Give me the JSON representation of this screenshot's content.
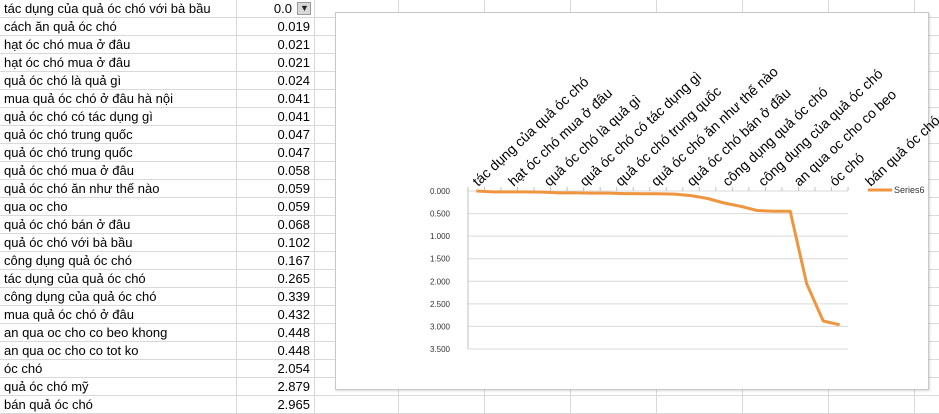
{
  "sheet": {
    "rows": [
      {
        "keyword": "tác dụng của quả óc chó với bà bầu",
        "value": "0.0"
      },
      {
        "keyword": "cách ăn quả óc chó",
        "value": "0.019"
      },
      {
        "keyword": "hạt óc chó mua ở đâu",
        "value": "0.021"
      },
      {
        "keyword": "hạt óc chó mua ở đâu",
        "value": "0.021"
      },
      {
        "keyword": "quả óc chó là quả gì",
        "value": "0.024"
      },
      {
        "keyword": "mua quả óc chó ở đâu hà nội",
        "value": "0.041"
      },
      {
        "keyword": "quả óc chó có tác dụng gì",
        "value": "0.041"
      },
      {
        "keyword": "quả óc chó trung quốc",
        "value": "0.047"
      },
      {
        "keyword": "quả óc chó trung quốc",
        "value": "0.047"
      },
      {
        "keyword": "quả óc chó mua ở đâu",
        "value": "0.058"
      },
      {
        "keyword": "quả óc chó ăn như thế nào",
        "value": "0.059"
      },
      {
        "keyword": "qua oc cho",
        "value": "0.059"
      },
      {
        "keyword": "quả óc chó bán ở đâu",
        "value": "0.068"
      },
      {
        "keyword": "quả óc chó với bà bầu",
        "value": "0.102"
      },
      {
        "keyword": "công dụng quả óc chó",
        "value": "0.167"
      },
      {
        "keyword": "tác dụng của quả óc chó",
        "value": "0.265"
      },
      {
        "keyword": "công dụng của quả óc chó",
        "value": "0.339"
      },
      {
        "keyword": "mua quả óc chó ở đâu",
        "value": "0.432"
      },
      {
        "keyword": "an qua oc cho co beo khong",
        "value": "0.448"
      },
      {
        "keyword": "an qua oc cho co tot ko",
        "value": "0.448"
      },
      {
        "keyword": "óc chó",
        "value": "2.054"
      },
      {
        "keyword": "quả óc chó mỹ",
        "value": "2.879"
      },
      {
        "keyword": "bán quả óc chó",
        "value": "2.965"
      }
    ]
  },
  "chart_data": {
    "type": "line",
    "y_inverted": true,
    "ylim": [
      0,
      3.5
    ],
    "y_ticks": [
      "0.000",
      "0.500",
      "1.000",
      "1.500",
      "2.000",
      "2.500",
      "3.000",
      "3.500"
    ],
    "categories": [
      "tác dụng của quả óc chó với bà bầu",
      "cách ăn quả óc chó",
      "hạt óc chó mua ở đâu",
      "hạt óc chó mua ở đâu",
      "quả óc chó là quả gì",
      "mua quả óc chó ở đâu hà nội",
      "quả óc chó có tác dụng gì",
      "quả óc chó trung quốc",
      "quả óc chó trung quốc",
      "quả óc chó mua ở đâu",
      "quả óc chó ăn như thế nào",
      "qua oc cho",
      "quả óc chó bán ở đâu",
      "quả óc chó với bà bầu",
      "công dụng quả óc chó",
      "tác dụng của quả óc chó",
      "công dụng của quả óc chó",
      "mua quả óc chó ở đâu",
      "an qua oc cho co beo khong",
      "an qua oc cho co tot ko",
      "óc chó",
      "quả óc chó mỹ",
      "bán quả óc chó"
    ],
    "visible_category_labels": [
      "tác dụng của quả óc chó",
      "hạt óc chó mua ở đâu",
      "quả óc chó là quả gì",
      "quả óc chó có tác dụng gì",
      "quả óc chó trung quốc",
      "quả óc chó ăn như thế nào",
      "quả óc chó bán ở đâu",
      "công dụng quả óc chó",
      "công dụng của quả óc chó",
      "an qua oc cho co beo",
      "óc chó",
      "bán quả óc chó"
    ],
    "series": [
      {
        "name": "Series6",
        "color": "#f0953f",
        "values": [
          0.0,
          0.019,
          0.021,
          0.021,
          0.024,
          0.041,
          0.041,
          0.047,
          0.047,
          0.058,
          0.059,
          0.059,
          0.068,
          0.102,
          0.167,
          0.265,
          0.339,
          0.432,
          0.448,
          0.448,
          2.054,
          2.879,
          2.965
        ]
      }
    ],
    "legend_position": "right",
    "grid": true
  }
}
